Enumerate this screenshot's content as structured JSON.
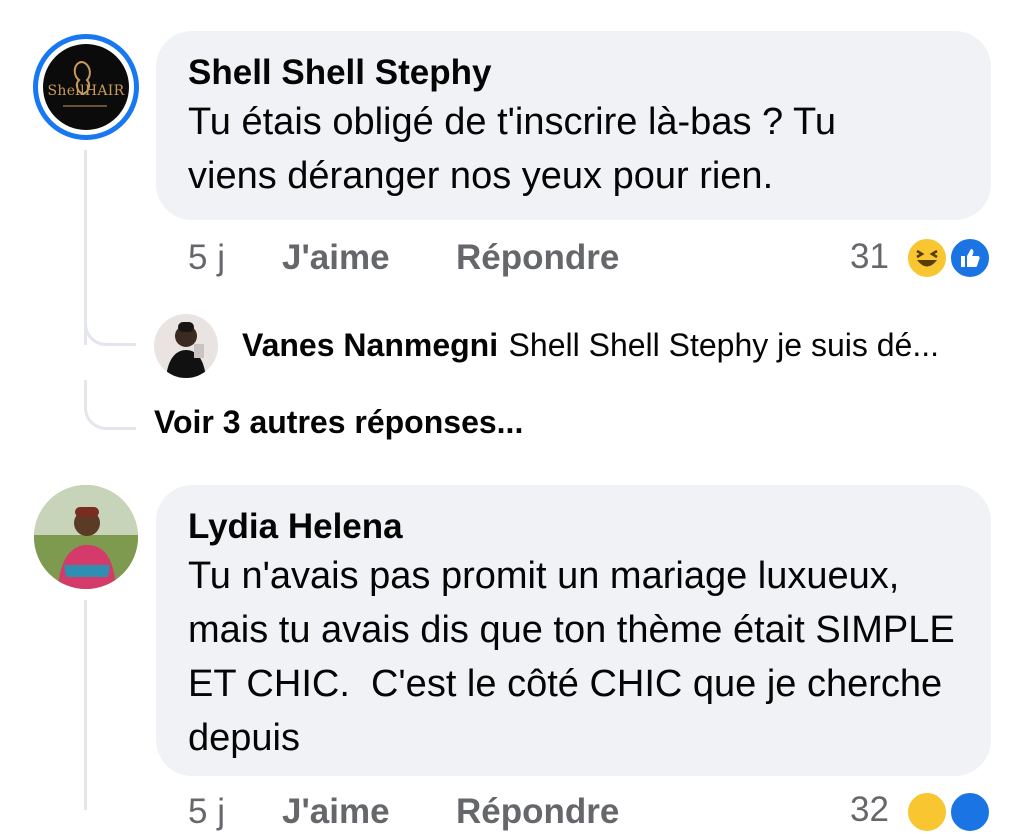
{
  "comments": [
    {
      "author": "Shell Shell Stephy",
      "text": "Tu étais obligé de t'inscrire là-bas ? Tu viens déranger nos yeux pour rien.",
      "time": "5 j",
      "like_label": "J'aime",
      "reply_label": "Répondre",
      "reaction_count": "31",
      "reactions": [
        "haha-icon",
        "like-icon"
      ],
      "avatar_logo_text": "ShellHAIR",
      "replies": [
        {
          "author": "Vanes Nanmegni",
          "text": "Shell Shell Stephy je suis dé..."
        }
      ],
      "more_replies_label": "Voir 3 autres réponses..."
    },
    {
      "author": "Lydia Helena",
      "text": "Tu n'avais pas promit un mariage luxueux, mais tu avais dis que ton thème était SIMPLE ET CHIC.  C'est le côté CHIC que je cherche depuis",
      "time": "5 j",
      "like_label": "J'aime",
      "reply_label": "Répondre",
      "reaction_count": "32"
    }
  ],
  "colors": {
    "accent": "#1877f2",
    "bubble": "#f0f2f5",
    "muted": "#65676b"
  }
}
